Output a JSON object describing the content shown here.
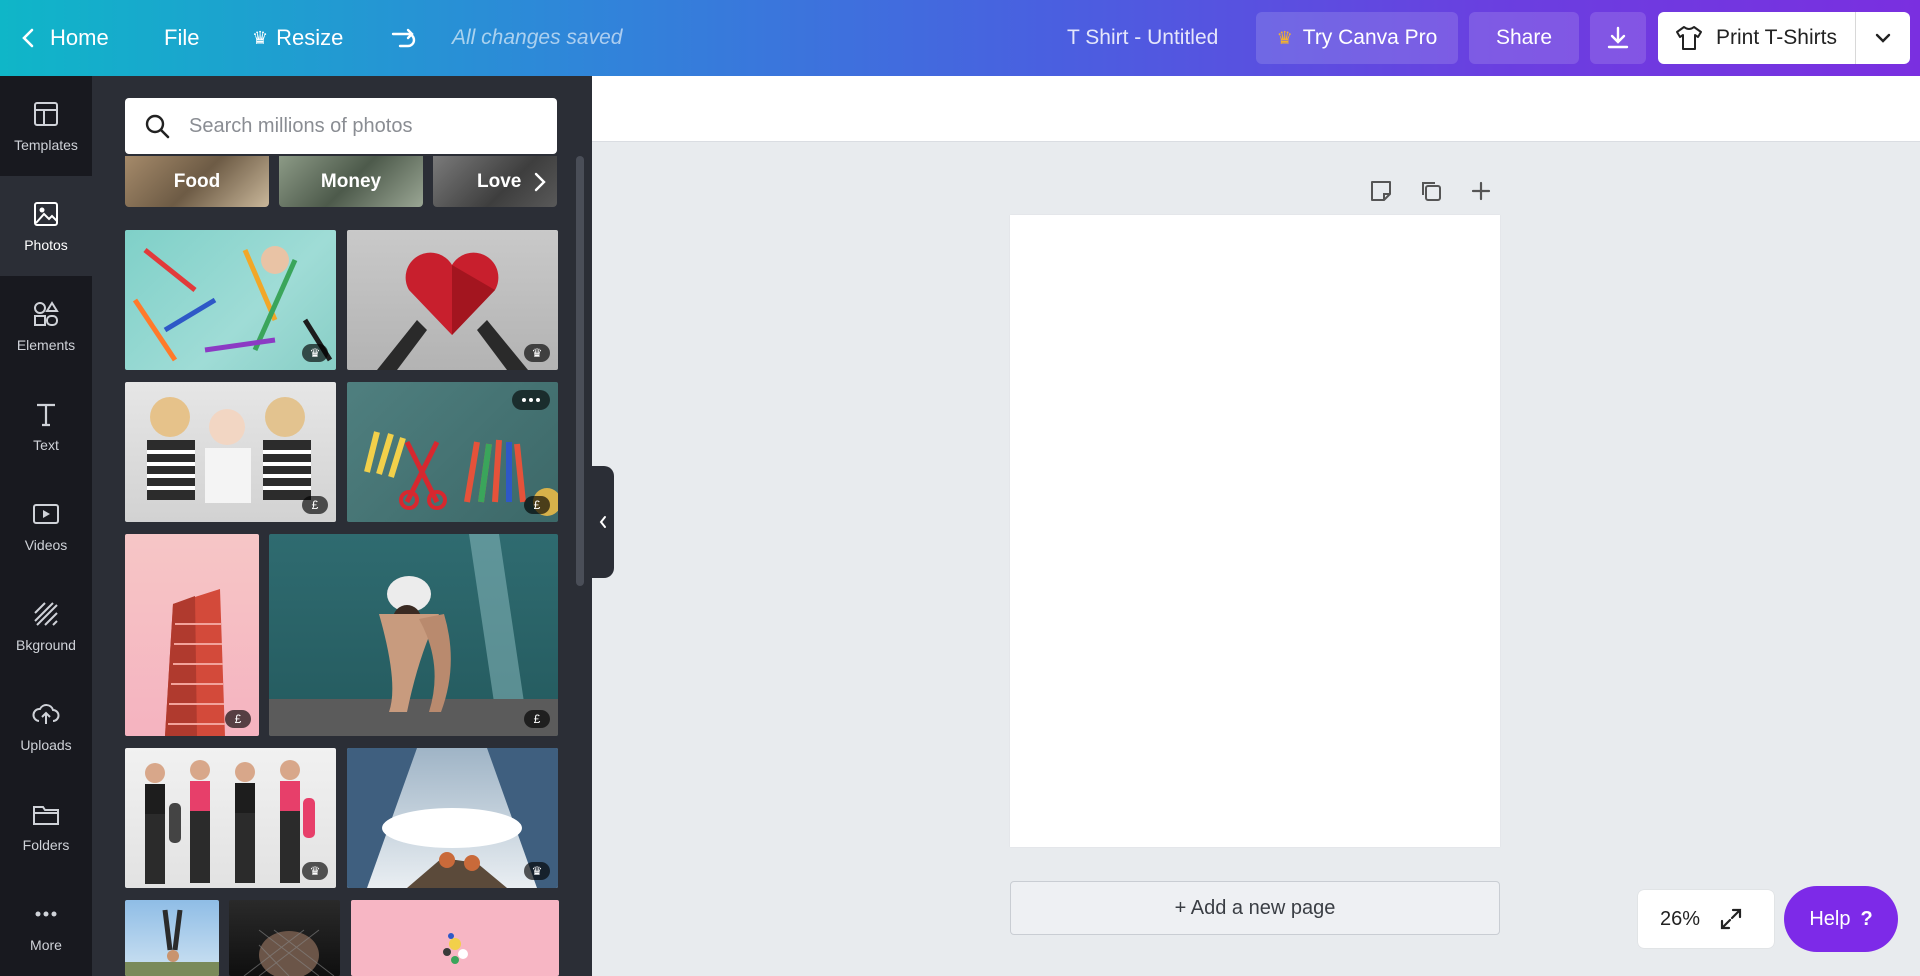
{
  "topbar": {
    "home_label": "Home",
    "file_label": "File",
    "resize_label": "Resize",
    "status": "All changes saved",
    "doc_title": "T Shirt - Untitled",
    "try_pro_label": "Try Canva Pro",
    "share_label": "Share",
    "print_label": "Print T-Shirts",
    "crown_color": "#f5b42a"
  },
  "rail": {
    "items": [
      {
        "label": "Templates",
        "icon": "templates-icon"
      },
      {
        "label": "Photos",
        "icon": "photos-icon",
        "active": true
      },
      {
        "label": "Elements",
        "icon": "elements-icon"
      },
      {
        "label": "Text",
        "icon": "text-icon"
      },
      {
        "label": "Videos",
        "icon": "videos-icon"
      },
      {
        "label": "Bkground",
        "icon": "background-icon"
      },
      {
        "label": "Uploads",
        "icon": "uploads-icon"
      },
      {
        "label": "Folders",
        "icon": "folders-icon"
      },
      {
        "label": "More",
        "icon": "more-icon"
      }
    ]
  },
  "panel": {
    "search_placeholder": "Search millions of photos",
    "categories": [
      "Food",
      "Money",
      "Love"
    ],
    "badges": {
      "premium": "♛",
      "paid": "£"
    }
  },
  "canvas": {
    "add_page_label": "+ Add a new page",
    "zoom_value": "26%",
    "help_label": "Help",
    "help_glyph": "?"
  }
}
